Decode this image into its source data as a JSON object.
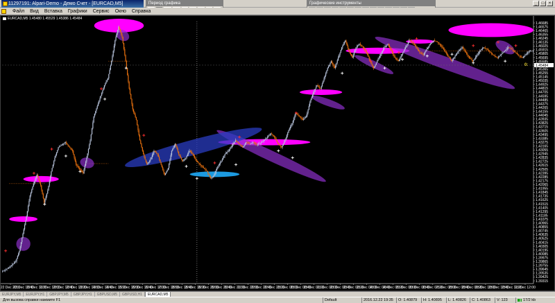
{
  "window": {
    "title": "11297191: Alpari-Demo - Демо Счет - [EURCAD,M5]",
    "icon": "terminal-icon"
  },
  "toolbars": {
    "period": {
      "caption": "Период графика",
      "buttons": [
        "M1",
        "M5",
        "M15",
        "M30",
        "H1",
        "H4",
        "D1",
        "W1",
        "MN"
      ],
      "active": "M5"
    },
    "graphic_tools": {
      "caption": "Графические инструменты"
    }
  },
  "menu": {
    "items": [
      "Файл",
      "Вид",
      "Вставка",
      "Графики",
      "Сервис",
      "Окно",
      "Справка"
    ]
  },
  "chart": {
    "header": "EURCAD,M5  1.45480 1.45529 1.45386 1.45484",
    "bid_label": "1.45484",
    "side_marker": "0:",
    "colors": {
      "background": "#000000",
      "up_candle": "#b8c4dc",
      "down_candle": "#e8700e",
      "magenta": "#ff00ff",
      "purple": "#8b2fc9",
      "blue": "#2a3cc0",
      "cyan": "#1c9ae0",
      "buy_marker": "#ff3030",
      "sell_marker": "#ffffff",
      "grid": "#c0c0c0"
    }
  },
  "chart_data": {
    "type": "candlestick",
    "symbol": "EURCAD",
    "timeframe": "M5",
    "last_bid": 1.45484,
    "ylim": [
      1.3915,
      1.4675
    ],
    "y_ticks": [
      "1.46685",
      "1.46575",
      "1.46465",
      "1.46355",
      "1.46245",
      "1.46135",
      "1.46025",
      "1.45915",
      "1.45805",
      "1.45695",
      "1.45585",
      "1.45475",
      "1.45365",
      "1.45255",
      "1.45145",
      "1.45035",
      "1.44925",
      "1.44815",
      "1.44705",
      "1.44595",
      "1.44485",
      "1.44375",
      "1.44265",
      "1.44155",
      "1.44045",
      "1.43935",
      "1.43825",
      "1.43715",
      "1.43605",
      "1.43495",
      "1.43385",
      "1.43275",
      "1.43165",
      "1.43055",
      "1.42945",
      "1.42835",
      "1.42725",
      "1.42615",
      "1.42505",
      "1.42395",
      "1.42285",
      "1.42175",
      "1.42065",
      "1.41955",
      "1.41845",
      "1.41735",
      "1.41625",
      "1.41515",
      "1.41405",
      "1.41295",
      "1.41185",
      "1.41075",
      "1.40965",
      "1.40855",
      "1.40745",
      "1.40635",
      "1.40525",
      "1.40415",
      "1.40305",
      "1.40195",
      "1.40085",
      "1.39975",
      "1.39865",
      "1.39755",
      "1.39645",
      "1.39535",
      "1.39425",
      "1.39315"
    ],
    "x_ticks": [
      "22 Dec 2016",
      "22 Dec 10:40",
      "22 Dec 11:20",
      "22 Dec 12:00",
      "22 Dec 12:40",
      "22 Dec 13:20",
      "22 Dec 14:00",
      "22 Dec 14:40",
      "22 Dec 15:20",
      "22 Dec 16:00",
      "22 Dec 16:40",
      "22 Dec 17:20",
      "22 Dec 18:00",
      "22 Dec 18:40",
      "22 Dec 19:20",
      "22 Dec 20:00",
      "22 Dec 20:40",
      "22 Dec 21:20",
      "22 Dec 22:00",
      "22 Dec 22:40",
      "22 Dec 23:20",
      "23 Dec 00:00",
      "23 Dec 00:40",
      "23 Dec 01:20",
      "23 Dec 02:00",
      "23 Dec 02:40",
      "23 Dec 03:20",
      "23 Dec 04:00",
      "23 Dec 04:40",
      "23 Dec 05:20",
      "23 Dec 06:00",
      "23 Dec 06:40",
      "23 Dec 07:20",
      "23 Dec 08:00",
      "23 Dec 08:40",
      "23 Dec 09:20",
      "23 Dec 10:00",
      "23 Dec 10:40",
      "23 Dec 11:20",
      "23 Dec 12:00"
    ],
    "path": [
      [
        0,
        1.395
      ],
      [
        2,
        1.396
      ],
      [
        4,
        1.398
      ],
      [
        5,
        1.401
      ],
      [
        6,
        1.406
      ],
      [
        7,
        1.411
      ],
      [
        8,
        1.417
      ],
      [
        9,
        1.4205
      ],
      [
        10,
        1.423
      ],
      [
        11,
        1.42
      ],
      [
        12,
        1.415
      ],
      [
        13,
        1.4185
      ],
      [
        14,
        1.424
      ],
      [
        15,
        1.428
      ],
      [
        16,
        1.431
      ],
      [
        18,
        1.4325
      ],
      [
        20,
        1.43
      ],
      [
        21,
        1.426
      ],
      [
        23,
        1.4235
      ],
      [
        24,
        1.428
      ],
      [
        25,
        1.433
      ],
      [
        26,
        1.44
      ],
      [
        27,
        1.443
      ],
      [
        28,
        1.446
      ],
      [
        29,
        1.449
      ],
      [
        30,
        1.451
      ],
      [
        31,
        1.456
      ],
      [
        32,
        1.462
      ],
      [
        33,
        1.466
      ],
      [
        34,
        1.463
      ],
      [
        35,
        1.456
      ],
      [
        36,
        1.448
      ],
      [
        37,
        1.442
      ],
      [
        38,
        1.439
      ],
      [
        39,
        1.433
      ],
      [
        40,
        1.429
      ],
      [
        41,
        1.426
      ],
      [
        42,
        1.4275
      ],
      [
        43,
        1.43
      ],
      [
        44,
        1.429
      ],
      [
        45,
        1.426
      ],
      [
        46,
        1.423
      ],
      [
        47,
        1.425
      ],
      [
        48,
        1.43
      ],
      [
        49,
        1.432
      ],
      [
        50,
        1.429
      ],
      [
        51,
        1.427
      ],
      [
        52,
        1.428
      ],
      [
        53,
        1.43
      ],
      [
        54,
        1.429
      ],
      [
        55,
        1.427
      ],
      [
        56,
        1.426
      ],
      [
        57,
        1.425
      ],
      [
        58,
        1.424
      ],
      [
        59,
        1.422
      ],
      [
        60,
        1.423
      ],
      [
        61,
        1.4255
      ],
      [
        62,
        1.427
      ],
      [
        63,
        1.429
      ],
      [
        64,
        1.43
      ],
      [
        65,
        1.4315
      ],
      [
        66,
        1.433
      ],
      [
        67,
        1.432
      ],
      [
        68,
        1.431
      ],
      [
        69,
        1.4325
      ],
      [
        70,
        1.432
      ],
      [
        71,
        1.4325
      ],
      [
        72,
        1.4318
      ],
      [
        73,
        1.4322
      ],
      [
        74,
        1.433
      ],
      [
        75,
        1.434
      ],
      [
        76,
        1.435
      ],
      [
        77,
        1.434
      ],
      [
        78,
        1.432
      ],
      [
        79,
        1.431
      ],
      [
        80,
        1.433
      ],
      [
        81,
        1.436
      ],
      [
        82,
        1.438
      ],
      [
        83,
        1.441
      ],
      [
        84,
        1.44
      ],
      [
        85,
        1.439
      ],
      [
        86,
        1.44
      ],
      [
        87,
        1.444
      ],
      [
        88,
        1.447
      ],
      [
        89,
        1.449
      ],
      [
        90,
        1.448
      ],
      [
        91,
        1.451
      ],
      [
        92,
        1.454
      ],
      [
        93,
        1.456
      ],
      [
        94,
        1.454
      ],
      [
        95,
        1.457
      ],
      [
        96,
        1.46
      ],
      [
        97,
        1.462
      ],
      [
        98,
        1.459
      ],
      [
        99,
        1.457
      ],
      [
        100,
        1.46
      ],
      [
        101,
        1.461
      ],
      [
        102,
        1.46
      ],
      [
        103,
        1.4585
      ],
      [
        104,
        1.456
      ],
      [
        105,
        1.454
      ],
      [
        106,
        1.456
      ],
      [
        107,
        1.458
      ],
      [
        108,
        1.46
      ],
      [
        109,
        1.461
      ],
      [
        110,
        1.459
      ],
      [
        111,
        1.457
      ],
      [
        112,
        1.456
      ],
      [
        113,
        1.458
      ],
      [
        114,
        1.46
      ],
      [
        115,
        1.462
      ],
      [
        116,
        1.4615
      ],
      [
        117,
        1.46
      ],
      [
        118,
        1.4585
      ],
      [
        119,
        1.4578
      ],
      [
        120,
        1.4595
      ],
      [
        121,
        1.461
      ],
      [
        122,
        1.462
      ],
      [
        123,
        1.4615
      ],
      [
        124,
        1.4605
      ],
      [
        125,
        1.459
      ],
      [
        126,
        1.4575
      ],
      [
        127,
        1.456
      ],
      [
        128,
        1.4575
      ],
      [
        129,
        1.459
      ],
      [
        130,
        1.46
      ],
      [
        131,
        1.4585
      ],
      [
        132,
        1.457
      ],
      [
        133,
        1.456
      ],
      [
        134,
        1.4575
      ],
      [
        135,
        1.459
      ],
      [
        136,
        1.46
      ],
      [
        137,
        1.4595
      ],
      [
        138,
        1.4585
      ],
      [
        139,
        1.4575
      ],
      [
        140,
        1.457
      ],
      [
        141,
        1.458
      ],
      [
        142,
        1.459
      ],
      [
        143,
        1.46
      ],
      [
        144,
        1.4595
      ],
      [
        145,
        1.4585
      ],
      [
        146,
        1.4575
      ],
      [
        147,
        1.457
      ],
      [
        148,
        1.458
      ],
      [
        149,
        1.459
      ]
    ],
    "ellipses": [
      {
        "type": "magenta",
        "cx": 33,
        "cy": 1.4663,
        "rx": 7,
        "ry": 0.002
      },
      {
        "type": "purple",
        "cx": 34,
        "cy": 1.4635,
        "rx": 2,
        "ry": 0.0015,
        "rot": 30
      },
      {
        "type": "magenta",
        "cx": 11,
        "cy": 1.4218,
        "rx": 5,
        "ry": 0.0009
      },
      {
        "type": "magenta",
        "cx": 6,
        "cy": 1.4102,
        "rx": 4,
        "ry": 0.0008
      },
      {
        "type": "purple",
        "cx": 6,
        "cy": 1.403,
        "rx": 2,
        "ry": 0.002,
        "rot": -20
      },
      {
        "type": "purple",
        "cx": 24,
        "cy": 1.4265,
        "rx": 2,
        "ry": 0.0015,
        "rot": 15
      },
      {
        "type": "magenta",
        "cx": 74,
        "cy": 1.4325,
        "rx": 13,
        "ry": 0.0009
      },
      {
        "type": "purple",
        "cx": 76,
        "cy": 1.4285,
        "rx": 17,
        "ry": 0.0015,
        "rot": 25
      },
      {
        "type": "blue",
        "cx": 54,
        "cy": 1.431,
        "rx": 20,
        "ry": 0.0022,
        "rot": -15
      },
      {
        "type": "cyan",
        "cx": 60,
        "cy": 1.4232,
        "rx": 7,
        "ry": 0.0008
      },
      {
        "type": "magenta",
        "cx": 90,
        "cy": 1.447,
        "rx": 6,
        "ry": 0.0008
      },
      {
        "type": "purple",
        "cx": 92,
        "cy": 1.444,
        "rx": 5,
        "ry": 0.001,
        "rot": 20
      },
      {
        "type": "magenta",
        "cx": 106,
        "cy": 1.459,
        "rx": 9,
        "ry": 0.0009
      },
      {
        "type": "purple",
        "cx": 105,
        "cy": 1.455,
        "rx": 6,
        "ry": 0.001,
        "rot": 25
      },
      {
        "type": "purple",
        "cx": 125,
        "cy": 1.4555,
        "rx": 21,
        "ry": 0.0018,
        "rot": 20
      },
      {
        "type": "magenta",
        "cx": 118,
        "cy": 1.4617,
        "rx": 4,
        "ry": 0.0006
      },
      {
        "type": "magenta",
        "cx": 138,
        "cy": 1.465,
        "rx": 12,
        "ry": 0.002
      },
      {
        "type": "purple",
        "cx": 142,
        "cy": 1.46,
        "rx": 3,
        "ry": 0.0015,
        "rot": 30
      }
    ],
    "vlines_at": [
      55,
      150
    ],
    "hlines": [
      {
        "x0": 30,
        "x1": 36,
        "y": 1.456,
        "color": "#e8700e"
      },
      {
        "x0": 2,
        "x1": 12,
        "y": 1.4205,
        "color": "#e8700e"
      },
      {
        "x0": 24,
        "x1": 30,
        "y": 1.4263,
        "color": "#e8700e"
      },
      {
        "x0": 118,
        "x1": 150,
        "y": 1.459,
        "color": "#e8700e"
      }
    ],
    "buy_markers": [
      [
        1,
        1.401
      ],
      [
        9,
        1.4235
      ],
      [
        14,
        1.4305
      ],
      [
        28,
        1.448
      ],
      [
        40,
        1.4345
      ],
      [
        60,
        1.4265
      ],
      [
        67,
        1.434
      ],
      [
        83,
        1.441
      ],
      [
        104,
        1.456
      ],
      [
        112,
        1.4585
      ],
      [
        117,
        1.4625
      ],
      [
        133,
        1.4605
      ],
      [
        140,
        1.4615
      ],
      [
        145,
        1.4605
      ]
    ],
    "sell_markers": [
      [
        12,
        1.4145
      ],
      [
        18,
        1.4285
      ],
      [
        22,
        1.424
      ],
      [
        29,
        1.445
      ],
      [
        35,
        1.454
      ],
      [
        52,
        1.4255
      ],
      [
        55,
        1.422
      ],
      [
        66,
        1.426
      ],
      [
        78,
        1.43
      ],
      [
        82,
        1.428
      ],
      [
        96,
        1.4525
      ],
      [
        108,
        1.454
      ],
      [
        113,
        1.4565
      ],
      [
        120,
        1.4575
      ],
      [
        127,
        1.458
      ],
      [
        133,
        1.4555
      ],
      [
        142,
        1.456
      ]
    ]
  },
  "tabs": {
    "items": [
      "EURJPY,M5",
      "EURJPY,H1",
      "GBPJPY,M5",
      "GBPJPY,H1",
      "GBPUSD,M5",
      "GBPUSD,H1",
      "EURCAD,M5"
    ],
    "active": "EURCAD,M5"
  },
  "status": {
    "help": "Для вызова справки нажмите F1",
    "profile": "Default",
    "datetime": "2016.12.22 19:35",
    "open": "O: 1.40879",
    "high": "H: 1.40895",
    "low": "L: 1.40826",
    "close": "C: 1.40863",
    "volume": "V: 123",
    "traffic": "17/2 kb"
  }
}
